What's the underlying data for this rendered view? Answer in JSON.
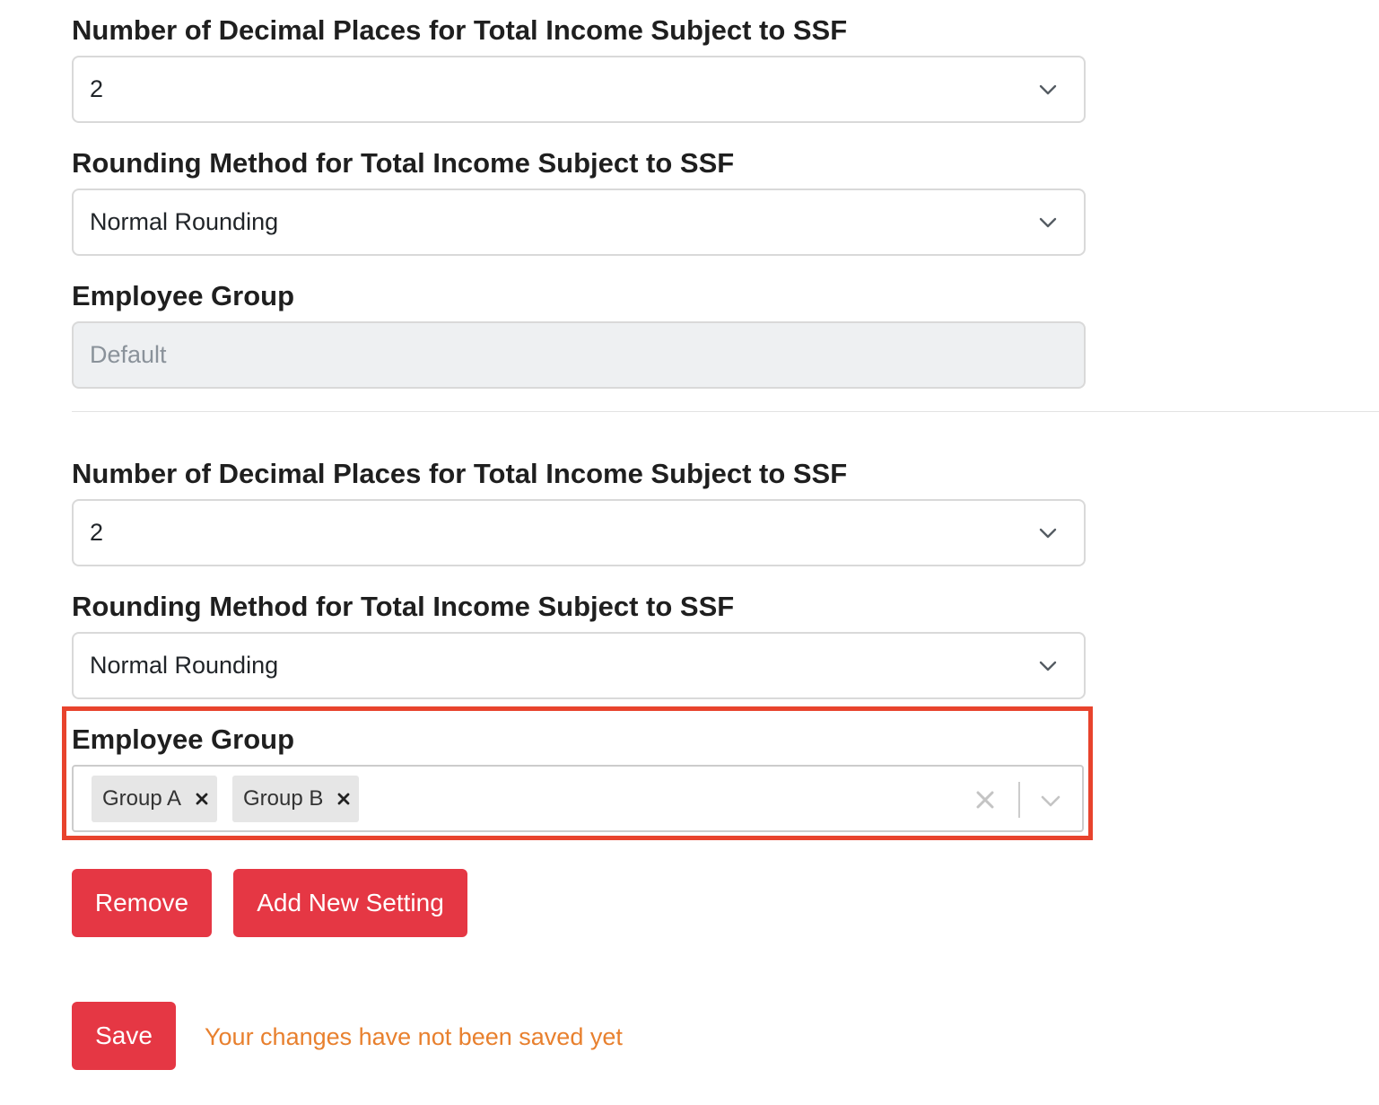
{
  "setting_1": {
    "decimal_label": "Number of Decimal Places for Total Income Subject to SSF",
    "decimal_value": "2",
    "rounding_label": "Rounding Method for Total Income Subject to SSF",
    "rounding_value": "Normal Rounding",
    "group_label": "Employee Group",
    "group_value": "Default"
  },
  "setting_2": {
    "decimal_label": "Number of Decimal Places for Total Income Subject to SSF",
    "decimal_value": "2",
    "rounding_label": "Rounding Method for Total Income Subject to SSF",
    "rounding_value": "Normal Rounding",
    "group_label": "Employee Group",
    "groups": [
      {
        "label": "Group A"
      },
      {
        "label": "Group B"
      }
    ]
  },
  "buttons": {
    "remove": "Remove",
    "add_new": "Add New Setting",
    "save": "Save"
  },
  "status_message": "Your changes have not been saved yet",
  "colors": {
    "button_red": "#e53744",
    "highlight_border": "#e8432d",
    "status_orange": "#e8802e"
  },
  "icons": {
    "select_chevron": "chevron-down-icon",
    "chip_remove": "close-icon",
    "clear_all": "clear-icon"
  }
}
